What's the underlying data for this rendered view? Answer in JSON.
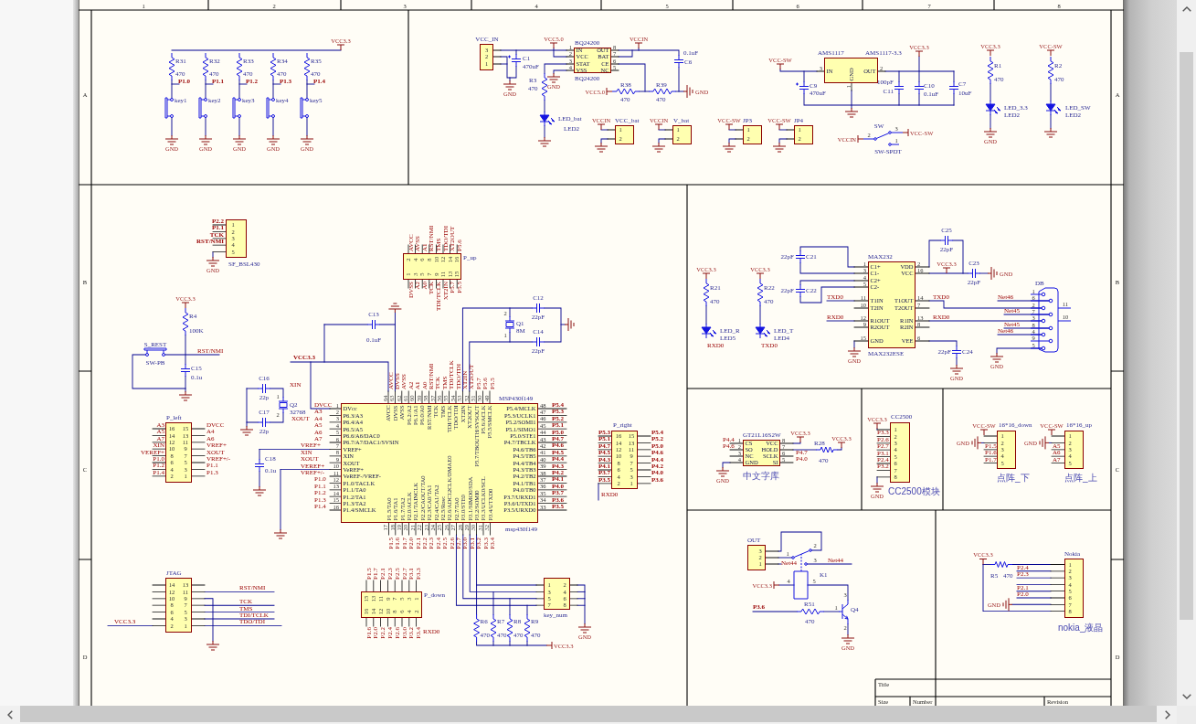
{
  "sheet": {
    "column_labels": [
      "1",
      "2",
      "3",
      "4",
      "5",
      "6",
      "7",
      "8"
    ],
    "row_labels_left": [
      "A",
      "B",
      "C",
      "D"
    ],
    "row_labels_right": [
      "A",
      "B",
      "C",
      "D"
    ]
  },
  "keys": {
    "parts": [
      {
        "kind": "resistor",
        "ref": "R31",
        "value": "470"
      },
      {
        "kind": "resistor",
        "ref": "R32",
        "value": "470"
      },
      {
        "kind": "resistor",
        "ref": "R33",
        "value": "470"
      },
      {
        "kind": "resistor",
        "ref": "R34",
        "value": "470"
      },
      {
        "kind": "resistor",
        "ref": "R35",
        "value": "470"
      },
      {
        "kind": "pushbutton",
        "ref": "key1"
      },
      {
        "kind": "pushbutton",
        "ref": "key2"
      },
      {
        "kind": "pushbutton",
        "ref": "key3"
      },
      {
        "kind": "pushbutton",
        "ref": "key4"
      },
      {
        "kind": "pushbutton",
        "ref": "key5"
      }
    ],
    "net_labels": [
      "P1.0",
      "P1.1",
      "P1.2",
      "P1.3",
      "P1.4"
    ],
    "power_ports": [
      {
        "kind": "vcc",
        "label": "VCC3.3"
      },
      {
        "kind": "gnd",
        "label": "GND"
      },
      {
        "kind": "gnd",
        "label": "GND"
      },
      {
        "kind": "gnd",
        "label": "GND"
      },
      {
        "kind": "gnd",
        "label": "GND"
      },
      {
        "kind": "gnd",
        "label": "GND"
      }
    ]
  },
  "power_supply": {
    "parts": [
      {
        "kind": "header",
        "ref": "VCC_IN",
        "pins": [
          "3",
          "2",
          "1"
        ]
      },
      {
        "kind": "polarized_capacitor",
        "ref": "C1",
        "value": "470uF"
      },
      {
        "kind": "ic",
        "ref": "BQ24200",
        "part": "BQ24200",
        "left_pins": [
          {
            "num": "1",
            "name": "IN"
          },
          {
            "num": "2",
            "name": "VCC"
          },
          {
            "num": "3",
            "name": "STAT"
          },
          {
            "num": "4",
            "name": "VSS"
          }
        ],
        "right_pins": [
          {
            "num": "8",
            "name": "OUT"
          },
          {
            "num": "7",
            "name": "BAT"
          },
          {
            "num": "6",
            "name": "CE"
          },
          {
            "num": "5",
            "name": "NC"
          }
        ]
      },
      {
        "kind": "capacitor",
        "ref": "C6",
        "value": "0.1uF"
      },
      {
        "kind": "resistor",
        "ref": "R3",
        "value": "470"
      },
      {
        "kind": "led",
        "ref": "LED2",
        "value": "LED_bat"
      },
      {
        "kind": "resistor",
        "ref": "R38",
        "value": "470"
      },
      {
        "kind": "resistor",
        "ref": "R39",
        "value": "470"
      },
      {
        "kind": "header",
        "ref": "VCC_bat",
        "pins": [
          "1",
          "2"
        ]
      },
      {
        "kind": "header",
        "ref": "V_bat",
        "pins": [
          "1",
          "2"
        ]
      },
      {
        "kind": "header",
        "ref": "JP3",
        "pins": [
          "1",
          "2"
        ]
      },
      {
        "kind": "header",
        "ref": "JP4",
        "pins": [
          "1",
          "2"
        ]
      },
      {
        "kind": "polarized_capacitor",
        "ref": "C9",
        "value": "470uF"
      },
      {
        "kind": "ic",
        "ref": "AMS1117",
        "part": "AMS1117-3.3",
        "left_pins": [
          {
            "num": "3",
            "name": "IN"
          }
        ],
        "bottom_pins": [
          {
            "num": "1",
            "name": "GND"
          }
        ],
        "right_pins": [
          {
            "num": "2",
            "name": "OUT"
          }
        ]
      },
      {
        "kind": "capacitor",
        "ref": "C11",
        "value": "100pF"
      },
      {
        "kind": "capacitor",
        "ref": "C10",
        "value": "0.1uF"
      },
      {
        "kind": "capacitor",
        "ref": "C7",
        "value": "10uF"
      },
      {
        "kind": "resistor",
        "ref": "R1",
        "value": "470"
      },
      {
        "kind": "led",
        "ref": "LED2",
        "value": "LED_3.3"
      },
      {
        "kind": "resistor",
        "ref": "R2",
        "value": "470"
      },
      {
        "kind": "led",
        "ref": "LED2",
        "value": "LED_SW"
      },
      {
        "kind": "switch",
        "ref": "SW",
        "value": "SW-SPDT",
        "pins": [
          "2",
          "3",
          "1"
        ]
      }
    ],
    "power_ports": [
      {
        "kind": "vcc",
        "label": "VCC5.0"
      },
      {
        "kind": "vcc",
        "label": "VCCIN"
      },
      {
        "kind": "vcc",
        "label": "VCC-SW"
      },
      {
        "kind": "vcc",
        "label": "VCC3.3"
      },
      {
        "kind": "vcc",
        "label": "VCC3.3"
      },
      {
        "kind": "vcc",
        "label": "VCC-SW"
      },
      {
        "kind": "gnd",
        "label": "GND"
      },
      {
        "kind": "gnd",
        "label": "GND"
      },
      {
        "kind": "vcc",
        "label": "VCC5.0"
      },
      {
        "kind": "gnd",
        "label": "GND"
      },
      {
        "kind": "gnd"
      },
      {
        "kind": "vcc",
        "label": "VCCIN"
      },
      {
        "kind": "vcc",
        "label": "VCCIN"
      },
      {
        "kind": "vcc",
        "label": "VCC-SW"
      },
      {
        "kind": "vcc",
        "label": "VCC-SW"
      },
      {
        "kind": "gnd",
        "label": "GND"
      },
      {
        "kind": "gnd"
      },
      {
        "kind": "vcc",
        "label": "VCC-SW"
      },
      {
        "kind": "vcc",
        "label": "VCCIN"
      },
      {
        "kind": "gnd"
      },
      {
        "kind": "gnd"
      },
      {
        "kind": "gnd"
      },
      {
        "kind": "gnd"
      },
      {
        "kind": "gnd"
      }
    ]
  },
  "mcu": {
    "parts": [
      {
        "kind": "header",
        "ref": "SF_BSL430",
        "pins": [
          "1",
          "2",
          "3",
          "4",
          "5"
        ]
      },
      {
        "kind": "header",
        "ref": "P_up",
        "pins": [
          "2",
          "4",
          "6",
          "8",
          "10",
          "12",
          "14",
          "16",
          "1",
          "3",
          "5",
          "7",
          "9",
          "11",
          "13",
          "15"
        ]
      },
      {
        "kind": "resistor",
        "ref": "R4",
        "value": "100K"
      },
      {
        "kind": "pushbutton",
        "ref": "S_REST",
        "value": "SW-PB"
      },
      {
        "kind": "capacitor",
        "ref": "C15",
        "value": "0.1u"
      },
      {
        "kind": "capacitor",
        "ref": "C13",
        "value": "0.1uF"
      },
      {
        "kind": "capacitor",
        "ref": "C12",
        "value": "22pF"
      },
      {
        "kind": "capacitor",
        "ref": "C14",
        "value": "22pF"
      },
      {
        "kind": "crystal",
        "ref": "Q1",
        "value": "8M",
        "pins": [
          "2",
          "1"
        ]
      },
      {
        "kind": "ic",
        "ref": "MSP430f149",
        "part": "msp430f149",
        "top_pins": [
          {
            "num": "64",
            "name": "AVCC"
          },
          {
            "num": "63",
            "name": "DVSS"
          },
          {
            "num": "62",
            "name": "AVSS"
          },
          {
            "num": "61",
            "name": "P6.2/A2"
          },
          {
            "num": "60",
            "name": "P6.1/A1"
          },
          {
            "num": "59",
            "name": "P6.0/A0"
          },
          {
            "num": "58",
            "name": "RST/NMI"
          },
          {
            "num": "57",
            "name": "TCK"
          },
          {
            "num": "56",
            "name": "TMS"
          },
          {
            "num": "55",
            "name": "TDI/TCLK"
          },
          {
            "num": "54",
            "name": "TDO/TDI"
          },
          {
            "num": "53",
            "name": "XT2IN"
          },
          {
            "num": "52",
            "name": "XT2OUT"
          },
          {
            "num": "51",
            "name": "P5.7/TBOUTH/SVSOUT"
          },
          {
            "num": "50",
            "name": "P5.6/ACLK"
          },
          {
            "num": "49",
            "name": "P5.5/SMCLK"
          }
        ],
        "left_pins": [
          {
            "num": "1",
            "name": "DVcc"
          },
          {
            "num": "2",
            "name": "P6.3/A3"
          },
          {
            "num": "3",
            "name": "P6.4/A4"
          },
          {
            "num": "4",
            "name": "P6.5/A5"
          },
          {
            "num": "5",
            "name": "P6.6/A6/DAC0"
          },
          {
            "num": "6",
            "name": "P6.7/A7/DAC1/SVSIN"
          },
          {
            "num": "7",
            "name": "VREF+"
          },
          {
            "num": "8",
            "name": "XIN"
          },
          {
            "num": "9",
            "name": "XOUT"
          },
          {
            "num": "10",
            "name": "VeREF+"
          },
          {
            "num": "11",
            "name": "VeREF-/VREF-"
          },
          {
            "num": "12",
            "name": "P1.0/TACLK"
          },
          {
            "num": "13",
            "name": "P1.1/TA0"
          },
          {
            "num": "14",
            "name": "P1.2/TA1"
          },
          {
            "num": "15",
            "name": "P1.3/TA2"
          },
          {
            "num": "16",
            "name": "P1.4/SMCLK"
          }
        ],
        "right_pins": [
          {
            "num": "48",
            "name": "P5.4/MCLK"
          },
          {
            "num": "47",
            "name": "P5.3/UCLK1"
          },
          {
            "num": "46",
            "name": "P5.2/SOMI1"
          },
          {
            "num": "45",
            "name": "P5.1/SIMO1"
          },
          {
            "num": "44",
            "name": "P5.0/STE1"
          },
          {
            "num": "43",
            "name": "P4.7/TBCLK"
          },
          {
            "num": "42",
            "name": "P4.6/TB6"
          },
          {
            "num": "41",
            "name": "P4.5/TB5"
          },
          {
            "num": "40",
            "name": "P4.4/TB4"
          },
          {
            "num": "39",
            "name": "P4.3/TB3"
          },
          {
            "num": "38",
            "name": "P4.2/TB2"
          },
          {
            "num": "37",
            "name": "P4.1/TB1"
          },
          {
            "num": "36",
            "name": "P4.0/TB0"
          },
          {
            "num": "35",
            "name": "P3.7/URXD1"
          },
          {
            "num": "34",
            "name": "P3.6/UTXD1"
          },
          {
            "num": "33",
            "name": "P3.5/URXD0"
          }
        ],
        "bottom_pins": [
          {
            "num": "17",
            "name": "P1.5/TA0"
          },
          {
            "num": "18",
            "name": "P1.6/TA1"
          },
          {
            "num": "19",
            "name": "P1.7/TA2"
          },
          {
            "num": "20",
            "name": "P2.0/ACLK"
          },
          {
            "num": "21",
            "name": "P2.1/TAINCLK"
          },
          {
            "num": "22",
            "name": "P2.2/CAOUT/TA0"
          },
          {
            "num": "23",
            "name": "P2.3/CA0/TA1"
          },
          {
            "num": "24",
            "name": "P2.4/CA1/TA2"
          },
          {
            "num": "25",
            "name": "P2.5/Rosc"
          },
          {
            "num": "26",
            "name": "P2.6/ADC12CLK/DMAE0"
          },
          {
            "num": "27",
            "name": "P2.7/TA0"
          },
          {
            "num": "28",
            "name": "P3.0/STE0"
          },
          {
            "num": "29",
            "name": "P3.1/SIMO0/SDA"
          },
          {
            "num": "30",
            "name": "P3.2/SOMI0"
          },
          {
            "num": "31",
            "name": "P3.3/UCLK0/SCL"
          },
          {
            "num": "32",
            "name": "P3.4/UTXD0"
          }
        ]
      },
      {
        "kind": "crystal",
        "ref": "Q2",
        "value": "32768",
        "pins": [
          "1",
          "2"
        ]
      },
      {
        "kind": "capacitor",
        "ref": "C16",
        "value": "22p"
      },
      {
        "kind": "capacitor",
        "ref": "C17",
        "value": "22p"
      },
      {
        "kind": "capacitor",
        "ref": "C18",
        "value": "0.1u"
      },
      {
        "kind": "header",
        "ref": "P_left",
        "pins": [
          "16",
          "14",
          "12",
          "10",
          "8",
          "6",
          "4",
          "2",
          "15",
          "13",
          "11",
          "9",
          "7",
          "5",
          "3",
          "1"
        ]
      },
      {
        "kind": "header",
        "ref": "P_right",
        "pins": [
          "16",
          "14",
          "12",
          "10",
          "8",
          "6",
          "4",
          "2",
          "15",
          "13",
          "11",
          "9",
          "7",
          "5",
          "3",
          "1"
        ]
      },
      {
        "kind": "header",
        "ref": "JTAG",
        "pins": [
          "14",
          "12",
          "10",
          "8",
          "6",
          "4",
          "2",
          "13",
          "11",
          "9",
          "7",
          "5",
          "3",
          "1"
        ]
      },
      {
        "kind": "header",
        "ref": "P_down",
        "pins": [
          "15",
          "13",
          "11",
          "9",
          "7",
          "5",
          "3",
          "1",
          "16",
          "14",
          "12",
          "10",
          "8",
          "6",
          "4",
          "2"
        ]
      },
      {
        "kind": "header",
        "ref": "key_num",
        "pins": [
          "1",
          "3",
          "5",
          "7",
          "2",
          "4",
          "6",
          "8"
        ]
      },
      {
        "kind": "resistor",
        "ref": "R6",
        "value": "470"
      },
      {
        "kind": "resistor",
        "ref": "R7",
        "value": "470"
      },
      {
        "kind": "resistor",
        "ref": "R8",
        "value": "470"
      },
      {
        "kind": "resistor",
        "ref": "R9",
        "value": "470"
      }
    ],
    "net_labels": [
      "P2.2",
      "P1.1",
      "TCK",
      "RST/NMI",
      "AVCC",
      "AVSS",
      "A1",
      "RST/NMI",
      "TMS",
      "TDO/TDI",
      "XT2OUT",
      "P5.6",
      "DVSS",
      "A2",
      "A0",
      "TCK",
      "TDI/TCLK",
      "XT2IN",
      "P5.7",
      "P5.5",
      "RST/NMI",
      "VCC3.3",
      "XIN",
      "XOUT",
      "AVCC",
      "DVSS",
      "AVSS",
      "A2",
      "A1",
      "A0",
      "RST/NMI",
      "TCK",
      "TMS",
      "TDI/TCLK",
      "TDO/TDI",
      "XT2IN",
      "XT2OUT",
      "P5.7",
      "P5.6",
      "P5.5",
      "DVCC",
      "A3",
      "A4",
      "A5",
      "A6",
      "A7",
      "VREF+",
      "XIN",
      "XOUT",
      "VEREF+",
      "VREF+/-",
      "P1.0",
      "P1.1",
      "P1.2",
      "P1.3",
      "P1.4",
      "P5.4",
      "P5.3",
      "P5.2",
      "P5.1",
      "P5.0",
      "P4.7",
      "P4.6",
      "P4.5",
      "P4.4",
      "P4.3",
      "P4.2",
      "P4.1",
      "P4.0",
      "P3.7",
      "P3.6",
      "P3.5",
      "P1.5",
      "P1.6",
      "P1.7",
      "P2.0",
      "P2.1",
      "P2.2",
      "P2.3",
      "P2.4",
      "P2.5",
      "P2.6",
      "P2.7",
      "P3.0",
      "P3.1",
      "P3.2",
      "P3.3",
      "P3.4",
      "A3",
      "A5",
      "A7",
      "XIN",
      "VEREF+",
      "P1.0",
      "P1.2",
      "P1.4",
      "DVCC",
      "A4",
      "A6",
      "VREF+",
      "XOUT",
      "VREF+/-",
      "P1.1",
      "P1.3",
      "RST/NMI",
      "TCK",
      "TMS",
      "TDI/TCLK",
      "TDO/TDI",
      "VCC3.3",
      "P1.5",
      "P1.7",
      "P2.1",
      "P2.3",
      "P2.5",
      "P2.7",
      "P3.1",
      "P3.3",
      "P1.6",
      "P2.0",
      "P2.2",
      "P2.4",
      "P2.6",
      "P3.0",
      "P3.2",
      "P3.4",
      "RXD0",
      "P5.3",
      "P5.1",
      "P4.7",
      "P4.5",
      "P4.3",
      "P4.1",
      "P3.7",
      "P3.5",
      "P5.4",
      "P5.2",
      "P5.0",
      "P4.6",
      "P4.4",
      "P4.2",
      "P4.0",
      "P3.6",
      "RXD0"
    ],
    "power_ports": [
      {
        "kind": "gnd",
        "label": "GND"
      },
      {
        "kind": "vcc",
        "label": "VCC3.3"
      },
      {
        "kind": "gnd"
      },
      {
        "kind": "gnd"
      },
      {
        "kind": "gnd"
      },
      {
        "kind": "gnd"
      },
      {
        "kind": "gnd"
      },
      {
        "kind": "gnd"
      },
      {
        "kind": "gnd"
      },
      {
        "kind": "gnd",
        "label": "GND"
      },
      {
        "kind": "vcc",
        "label": "VCC3.3"
      }
    ]
  },
  "rs232": {
    "parts": [
      {
        "kind": "capacitor",
        "ref": "C21",
        "value": "22pF"
      },
      {
        "kind": "resistor",
        "ref": "R21",
        "value": "470"
      },
      {
        "kind": "resistor",
        "ref": "R22",
        "value": "470"
      },
      {
        "kind": "capacitor",
        "ref": "C22",
        "value": "22pF"
      },
      {
        "kind": "led",
        "ref": "LED5",
        "value": "LED_R"
      },
      {
        "kind": "led",
        "ref": "LED4",
        "value": "LED_T"
      },
      {
        "kind": "ic",
        "ref": "MAX232",
        "part": "MAX232ESE",
        "left_pins": [
          {
            "num": "1",
            "name": "C1+"
          },
          {
            "num": "3",
            "name": "C1-"
          },
          {
            "num": "4",
            "name": "C2+"
          },
          {
            "num": "5",
            "name": "C2-"
          },
          {
            "num": "11",
            "name": "T1IN"
          },
          {
            "num": "10",
            "name": "T2IN"
          },
          {
            "num": "12",
            "name": "R1OUT"
          },
          {
            "num": "9",
            "name": "R2OUT"
          },
          {
            "num": "15",
            "name": "GND"
          }
        ],
        "right_pins": [
          {
            "num": "2",
            "name": "VDD"
          },
          {
            "num": "16",
            "name": "VCC"
          },
          {
            "num": "14",
            "name": "T1OUT"
          },
          {
            "num": "7",
            "name": "T2OUT"
          },
          {
            "num": "13",
            "name": "R1IN"
          },
          {
            "num": "8",
            "name": "R2IN"
          },
          {
            "num": "6",
            "name": "VEE"
          }
        ]
      },
      {
        "kind": "capacitor",
        "ref": "C25",
        "value": "22pF"
      },
      {
        "kind": "capacitor",
        "ref": "C23",
        "value": "22pF"
      },
      {
        "kind": "capacitor",
        "ref": "C24",
        "value": "22pF"
      },
      {
        "kind": "db9",
        "ref": "DB",
        "pins": [
          "1",
          "6",
          "2",
          "7",
          "3",
          "8",
          "4",
          "9",
          "5",
          "11",
          "10"
        ]
      }
    ],
    "net_labels": [
      "RXD0",
      "TXD0",
      "TXD0",
      "RXD0",
      "TXD0",
      "RXD0",
      "Net46",
      "Net45",
      "Net45",
      "Net46"
    ],
    "power_ports": [
      {
        "kind": "vcc",
        "label": "VCC3.3"
      },
      {
        "kind": "vcc",
        "label": "VCC3.3"
      },
      {
        "kind": "vcc",
        "label": "VCC3.3"
      },
      {
        "kind": "gnd",
        "label": "GND"
      },
      {
        "kind": "gnd",
        "label": "GND"
      },
      {
        "kind": "gnd",
        "label": "GND"
      },
      {
        "kind": "gnd",
        "label": "GND"
      }
    ]
  },
  "font_chip": {
    "parts": [
      {
        "kind": "ic",
        "ref": "GT21L16S2W",
        "part": "中文字库",
        "left_pins": [
          {
            "num": "1",
            "name": "CS"
          },
          {
            "num": "2",
            "name": "SO"
          },
          {
            "num": "3",
            "name": "NC"
          },
          {
            "num": "4",
            "name": "GND"
          }
        ],
        "right_pins": [
          {
            "num": "8",
            "name": "VCC"
          },
          {
            "num": "7",
            "name": "HOLD"
          },
          {
            "num": "6",
            "name": "SCLK"
          },
          {
            "num": "5",
            "name": "SI"
          }
        ]
      },
      {
        "kind": "resistor",
        "ref": "R28",
        "value": "470"
      }
    ],
    "net_labels": [
      "P4.4",
      "P4.6",
      "P4.7",
      "P4.0"
    ],
    "power_ports": [
      {
        "kind": "vcc",
        "label": "VCC3.3"
      },
      {
        "kind": "vcc",
        "label": "VCC3.3"
      },
      {
        "kind": "gnd",
        "label": "GND"
      }
    ]
  },
  "cc2500": {
    "parts": [
      {
        "kind": "header",
        "ref": "CC2500",
        "part": "CC2500模块",
        "pins": [
          "1",
          "2",
          "3",
          "4",
          "5",
          "6",
          "7",
          "8"
        ]
      }
    ],
    "net_labels": [
      "P3.3",
      "P2.6",
      "P2.7",
      "P3.1",
      "P2.4",
      "P3.2"
    ],
    "power_ports": [
      {
        "kind": "vcc",
        "label": "VCC3.3"
      },
      {
        "kind": "gnd",
        "label": "GND"
      }
    ]
  },
  "dot_matrix": {
    "parts": [
      {
        "kind": "header",
        "ref": "16*16_down",
        "part": "点阵_下",
        "pins": [
          "1",
          "2",
          "3",
          "4",
          "5"
        ]
      },
      {
        "kind": "header",
        "ref": "16*16_up",
        "part": "点阵_上",
        "pins": [
          "1",
          "2",
          "3",
          "4",
          "5"
        ]
      }
    ],
    "net_labels": [
      "P1.5",
      "P1.6",
      "P1.7",
      "A5",
      "A6",
      "A7"
    ],
    "power_ports": [
      {
        "kind": "vcc",
        "label": "VCC-SW"
      },
      {
        "kind": "gnd",
        "label": "GND"
      },
      {
        "kind": "vcc",
        "label": "VCC-SW"
      },
      {
        "kind": "gnd",
        "label": "GND"
      }
    ]
  },
  "relay": {
    "parts": [
      {
        "kind": "header",
        "ref": "OUT",
        "pins": [
          "3",
          "2",
          "1"
        ]
      },
      {
        "kind": "relay",
        "ref": "K1",
        "pins": [
          "2",
          "1",
          "3",
          "4",
          "5"
        ]
      },
      {
        "kind": "resistor",
        "ref": "R51",
        "value": "470"
      },
      {
        "kind": "transistor",
        "ref": "Q4",
        "pins": [
          "3",
          "1",
          "2"
        ]
      }
    ],
    "net_labels": [
      "Net44",
      "Net44",
      "P3.6"
    ],
    "power_ports": [
      {
        "kind": "vcc",
        "label": "VCC3.3"
      },
      {
        "kind": "gnd",
        "label": "GND"
      }
    ]
  },
  "nokia": {
    "parts": [
      {
        "kind": "resistor",
        "ref": "R5",
        "value": "470"
      },
      {
        "kind": "header",
        "ref": "Nokia",
        "part": "nokia_液晶",
        "pins": [
          "1",
          "2",
          "3",
          "4",
          "5",
          "6",
          "7",
          "8"
        ]
      }
    ],
    "net_labels": [
      "P2.4",
      "P2.3",
      "P2.1",
      "P2.0"
    ],
    "power_ports": [
      {
        "kind": "vcc",
        "label": "VCC3.3"
      },
      {
        "kind": "gnd",
        "label": "GND"
      }
    ]
  },
  "title_block": {
    "title_label": "Title",
    "size_label": "Size",
    "number_label": "Number",
    "revision_label": "Revision"
  }
}
